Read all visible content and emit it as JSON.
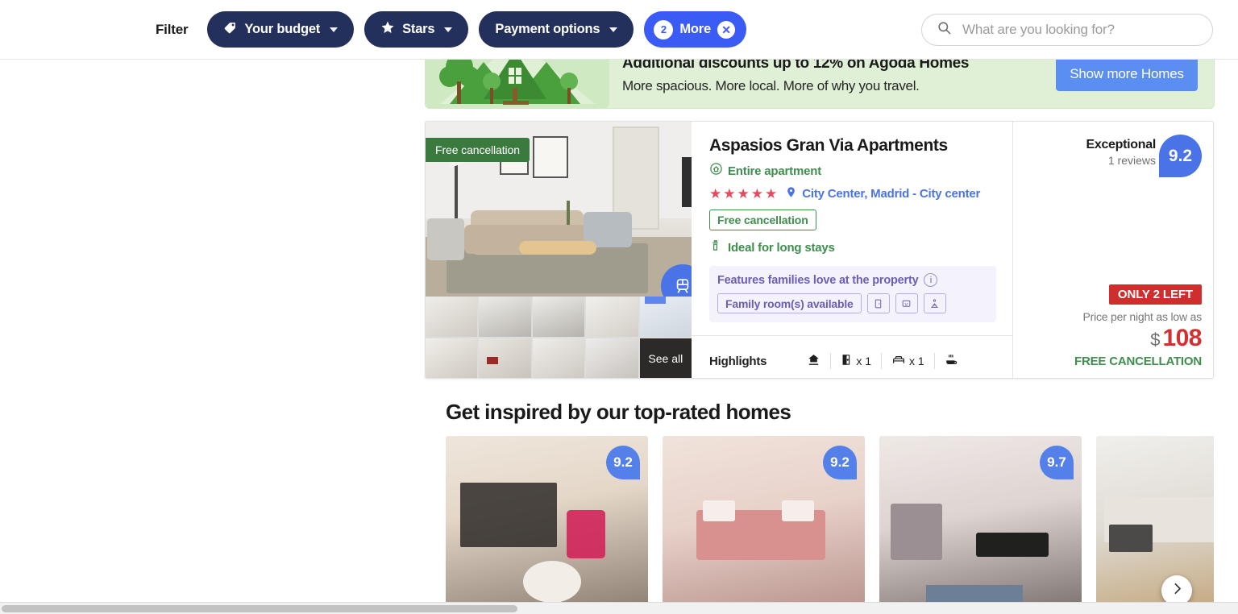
{
  "topbar": {
    "filter_label": "Filter",
    "pills": [
      {
        "label": "Your budget",
        "icon": "tag-icon",
        "has_caret": true,
        "style": "dark"
      },
      {
        "label": "Stars",
        "icon": "star-icon",
        "has_caret": true,
        "style": "dark"
      },
      {
        "label": "Payment options",
        "icon": "",
        "has_caret": true,
        "style": "dark"
      },
      {
        "label": "More",
        "icon": "",
        "count": "2",
        "close": "✕",
        "style": "blue"
      }
    ],
    "search": {
      "placeholder": "What are you looking for?",
      "icon": "search-icon"
    }
  },
  "promo": {
    "title": "Additional discounts up to 12% on Agoda Homes",
    "subtitle": "More spacious. More local. More of why you travel.",
    "button": "Show more Homes",
    "art": "house-and-trees-illustration"
  },
  "property": {
    "name": "Aspasios Gran Via Apartments",
    "type": "Entire apartment",
    "type_icon": "home-badge-icon",
    "stars": 5,
    "star_glyph": "★",
    "location_icon": "map-pin-icon",
    "location": "City Center, Madrid - City center",
    "free_cancellation_tag": "Free cancellation",
    "free_cancellation_box": "Free cancellation",
    "long_stays_icon": "long-stay-icon",
    "long_stays": "Ideal for long stays",
    "transit_badge_icon": "train-icon",
    "family": {
      "title": "Features families love at the property",
      "info_icon": "info-icon",
      "chips": [
        {
          "label": "Family room(s) available",
          "icon": ""
        },
        {
          "label": "",
          "icon": "crib-icon",
          "glyph": "□"
        },
        {
          "label": "",
          "icon": "kids-tv-icon",
          "glyph": "▢"
        },
        {
          "label": "",
          "icon": "playground-icon",
          "glyph": "⚐"
        }
      ]
    },
    "highlights": {
      "label": "Highlights",
      "items": [
        {
          "icon": "property-icon",
          "value": ""
        },
        {
          "icon": "door-icon",
          "value": "x 1"
        },
        {
          "icon": "bed-icon",
          "value": "x 1"
        },
        {
          "icon": "breakfast-icon",
          "value": ""
        }
      ]
    },
    "gallery": {
      "see_all": "See all",
      "thumb_count": 10
    },
    "rating": {
      "word": "Exceptional",
      "reviews": "1 reviews",
      "score": "9.2"
    },
    "price": {
      "urgency": "ONLY 2 LEFT",
      "caption": "Price per night as low as",
      "currency": "$",
      "amount": "108",
      "free_cancellation": "FREE CANCELLATION"
    }
  },
  "inspired": {
    "title": "Get inspired by our top-rated homes",
    "cards": [
      {
        "score": "9.2"
      },
      {
        "score": "9.2"
      },
      {
        "score": "9.7"
      },
      {
        "score": ""
      }
    ],
    "next_icon": "chevron-right-icon"
  },
  "colors": {
    "accent_blue": "#3b5bf5",
    "dark_navy": "#23305c",
    "green": "#3e8e4d",
    "red": "#cf2e2e",
    "purple": "#6b5fb5"
  }
}
